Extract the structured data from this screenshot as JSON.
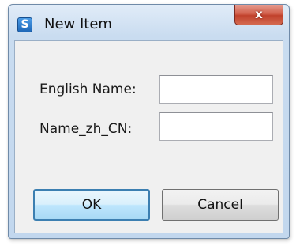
{
  "window": {
    "title": "New Item",
    "icon": "app-s-icon",
    "icon_glyph": "S",
    "close_glyph": "x"
  },
  "form": {
    "english_name": {
      "label": "English Name:",
      "value": "",
      "placeholder": ""
    },
    "name_zh_cn": {
      "label": "Name_zh_CN:",
      "value": "",
      "placeholder": ""
    }
  },
  "buttons": {
    "ok_label": "OK",
    "cancel_label": "Cancel"
  },
  "colors": {
    "title_bar": "#c9dcf0",
    "close_button": "#c7503c",
    "ok_border": "#3c7fb1",
    "client_bg": "#f0f0f0"
  }
}
